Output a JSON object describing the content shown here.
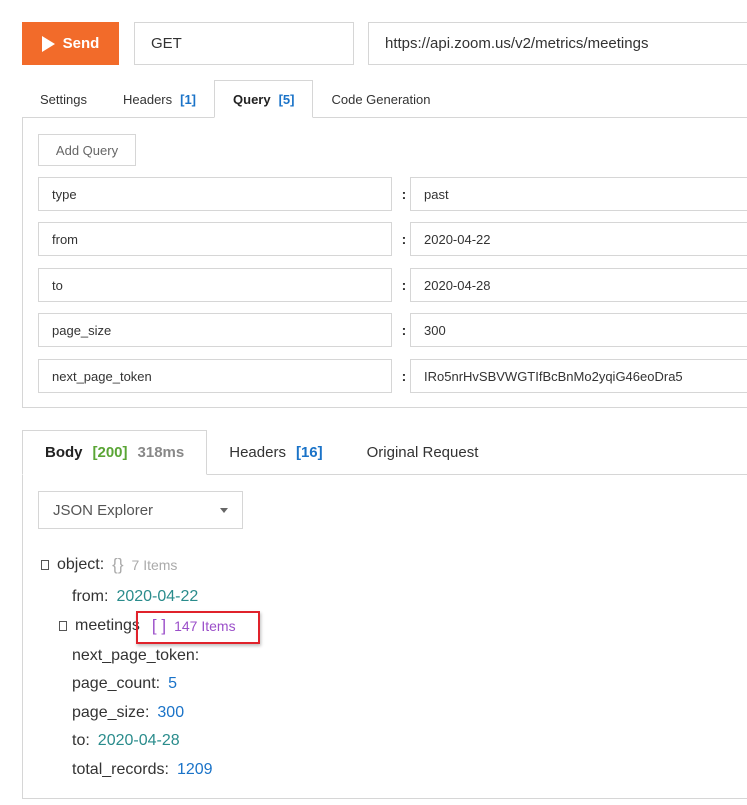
{
  "request": {
    "send_label": "Send",
    "method": "GET",
    "url": "https://api.zoom.us/v2/metrics/meetings"
  },
  "request_tabs": [
    {
      "label": "Settings",
      "count": ""
    },
    {
      "label": "Headers",
      "count": "[1]"
    },
    {
      "label": "Query",
      "count": "[5]"
    },
    {
      "label": "Code Generation",
      "count": ""
    }
  ],
  "query": {
    "add_label": "Add Query",
    "separator": ":",
    "params": [
      {
        "key": "type",
        "value": "past"
      },
      {
        "key": "from",
        "value": "2020-04-22"
      },
      {
        "key": "to",
        "value": "2020-04-28"
      },
      {
        "key": "page_size",
        "value": "300"
      },
      {
        "key": "next_page_token",
        "value": "IRo5nrHvSBVWGTIfBcBnMo2yqiG46eoDra5"
      }
    ]
  },
  "response_tabs": {
    "body": {
      "label": "Body",
      "status": "[200]",
      "time": "318ms"
    },
    "headers": {
      "label": "Headers",
      "count": "[16]"
    },
    "original": {
      "label": "Original Request"
    }
  },
  "viewer": {
    "selected": "JSON Explorer"
  },
  "json_tree": {
    "root": {
      "key": "object",
      "brace": "{}",
      "items": "7 Items"
    },
    "from": {
      "key": "from",
      "value": "2020-04-22"
    },
    "meetings": {
      "key": "meetings",
      "brace": "[ ]",
      "items": "147 Items"
    },
    "next_page_token": {
      "key": "next_page_token",
      "value": ""
    },
    "page_count": {
      "key": "page_count",
      "value": "5"
    },
    "page_size": {
      "key": "page_size",
      "value": "300"
    },
    "to": {
      "key": "to",
      "value": "2020-04-28"
    },
    "total_records": {
      "key": "total_records",
      "value": "1209"
    }
  },
  "colors": {
    "send": "#f26b2a",
    "count_blue": "#1a73c8",
    "status_green": "#5aa535",
    "string_teal": "#2a8c8c",
    "array_purple": "#9b4fc9",
    "highlight_red": "#e0222b"
  }
}
